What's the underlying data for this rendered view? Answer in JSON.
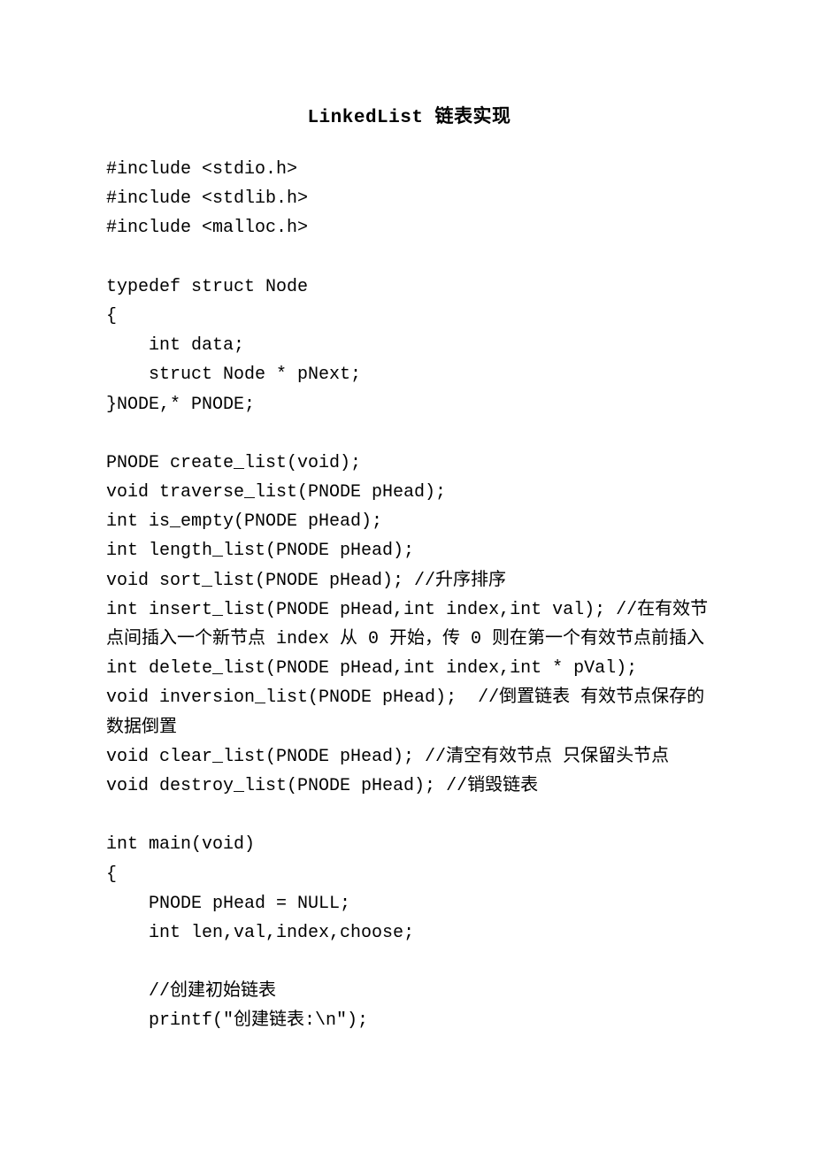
{
  "title": "LinkedList 链表实现",
  "code": "#include <stdio.h>\n#include <stdlib.h>\n#include <malloc.h>\n\ntypedef struct Node\n{\n    int data;\n    struct Node * pNext;\n}NODE,* PNODE;\n\nPNODE create_list(void);\nvoid traverse_list(PNODE pHead);\nint is_empty(PNODE pHead);\nint length_list(PNODE pHead);\nvoid sort_list(PNODE pHead); //升序排序\nint insert_list(PNODE pHead,int index,int val); //在有效节点间插入一个新节点 index 从 0 开始，传 0 则在第一个有效节点前插入\nint delete_list(PNODE pHead,int index,int * pVal);\nvoid inversion_list(PNODE pHead);  //倒置链表 有效节点保存的数据倒置\nvoid clear_list(PNODE pHead); //清空有效节点 只保留头节点\nvoid destroy_list(PNODE pHead); //销毁链表\n\nint main(void)\n{\n    PNODE pHead = NULL;\n    int len,val,index,choose;\n\n    //创建初始链表\n    printf(\"创建链表:\\n\");"
}
